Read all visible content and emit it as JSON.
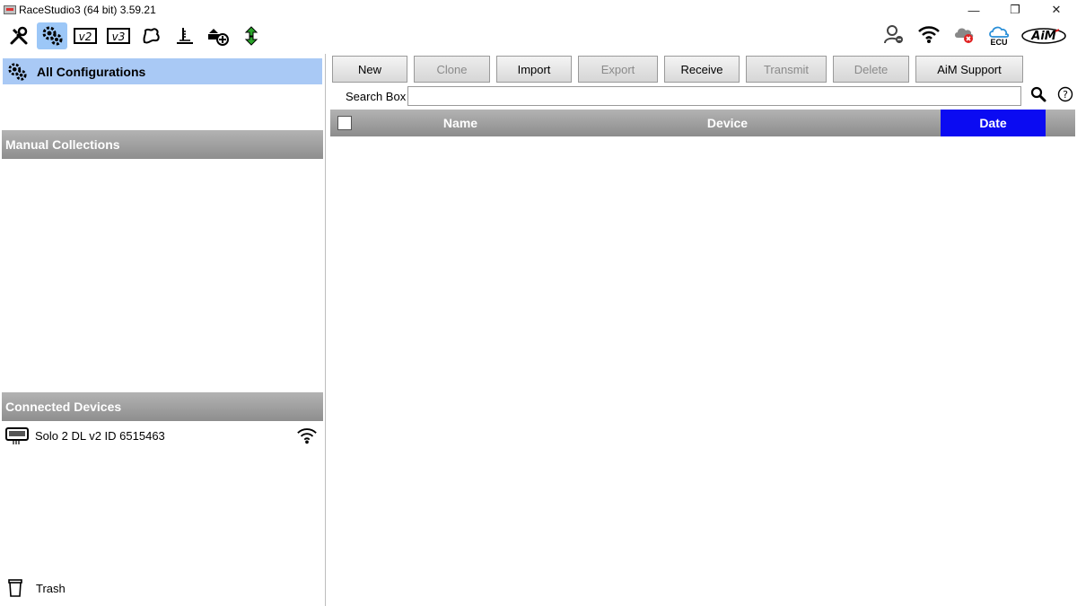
{
  "window": {
    "title": "RaceStudio3 (64 bit) 3.59.21",
    "controls": {
      "minimize": "—",
      "restore": "❐",
      "close": "✕"
    }
  },
  "toolbar": {
    "buttons": [
      {
        "icon": "wrench-screwdriver-icon"
      },
      {
        "icon": "gear-configurations-icon"
      },
      {
        "icon": "v2-device-icon"
      },
      {
        "icon": "v3-device-icon"
      },
      {
        "icon": "track-map-icon"
      },
      {
        "icon": "firmware-icon"
      },
      {
        "icon": "download-device-icon"
      },
      {
        "icon": "transfer-arrows-icon"
      }
    ],
    "right": {
      "ecu_label": "ECU",
      "logo_text": "AiM"
    }
  },
  "sidebar": {
    "all_configurations": "All Configurations",
    "manual_collections": "Manual Collections",
    "connected_devices": "Connected Devices",
    "devices": [
      {
        "label": "Solo 2 DL v2 ID 6515463"
      }
    ],
    "trash": "Trash"
  },
  "actions": [
    {
      "label": "New",
      "enabled": true
    },
    {
      "label": "Clone",
      "enabled": false
    },
    {
      "label": "Import",
      "enabled": true
    },
    {
      "label": "Export",
      "enabled": false
    },
    {
      "label": "Receive",
      "enabled": true
    },
    {
      "label": "Transmit",
      "enabled": false
    },
    {
      "label": "Delete",
      "enabled": false
    },
    {
      "label": "AiM Support",
      "enabled": true
    }
  ],
  "search": {
    "label": "Search Box",
    "value": ""
  },
  "table": {
    "columns": [
      "Name",
      "Device",
      "Date"
    ],
    "sorted_column": "Date",
    "sorted_color": "#0b0bf2",
    "rows": []
  },
  "colors": {
    "selection": "#a9c9f5",
    "header_gray": "#9e9e9e",
    "accent_red": "#e02020",
    "ok_green": "#2aa52a",
    "cloud_blue": "#2a8fd8"
  }
}
